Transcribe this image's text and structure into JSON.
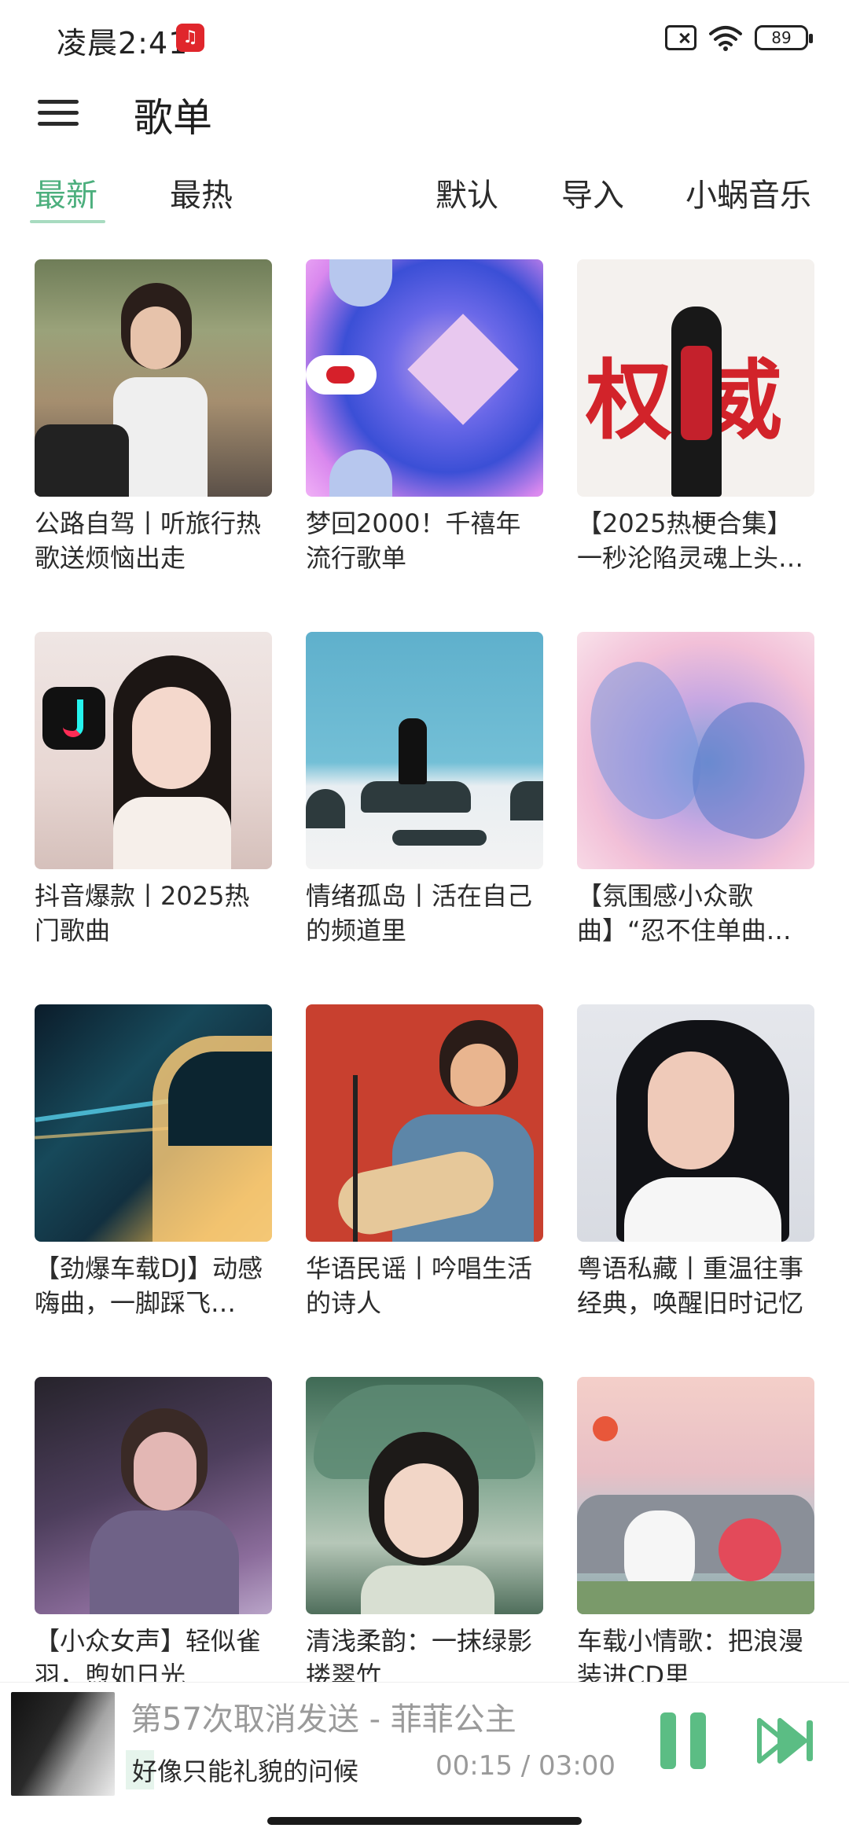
{
  "status_bar": {
    "time": "凌晨2:41",
    "battery": "89"
  },
  "header": {
    "title": "歌单"
  },
  "tabs": {
    "left": [
      {
        "label": "最新",
        "active": true
      },
      {
        "label": "最热",
        "active": false
      }
    ],
    "right": [
      {
        "label": "默认"
      },
      {
        "label": "导入"
      },
      {
        "label": "小蜗音乐"
      }
    ]
  },
  "playlists": [
    {
      "title": "公路自驾丨听旅行热歌送烦恼出走"
    },
    {
      "title": "梦回2000！千禧年流行歌单"
    },
    {
      "title": "【2025热梗合集】一秒沦陷灵魂上头…"
    },
    {
      "title": "抖音爆款丨2025热门歌曲"
    },
    {
      "title": "情绪孤岛丨活在自己的频道里"
    },
    {
      "title": "【氛围感小众歌曲】“忍不住单曲循环！”"
    },
    {
      "title": "【劲爆车载DJ】动感嗨曲，一脚踩飞…"
    },
    {
      "title": "华语民谣丨吟唱生活的诗人"
    },
    {
      "title": "粤语私藏丨重温往事经典，唤醒旧时记忆"
    },
    {
      "title": "【小众女声】轻似雀羽，煦如日光"
    },
    {
      "title": "清浅柔韵：一抹绿影搂翠竹"
    },
    {
      "title": "车载小情歌：把浪漫装进CD里"
    }
  ],
  "cover_art": {
    "c3_text": "权威"
  },
  "player": {
    "track": "第57次取消发送 - 菲菲公主",
    "lyric": "好像只能礼貌的问候",
    "time": "00:15 / 03:00"
  },
  "colors": {
    "accent": "#4caf7d",
    "play_controls": "#5bbd84"
  }
}
